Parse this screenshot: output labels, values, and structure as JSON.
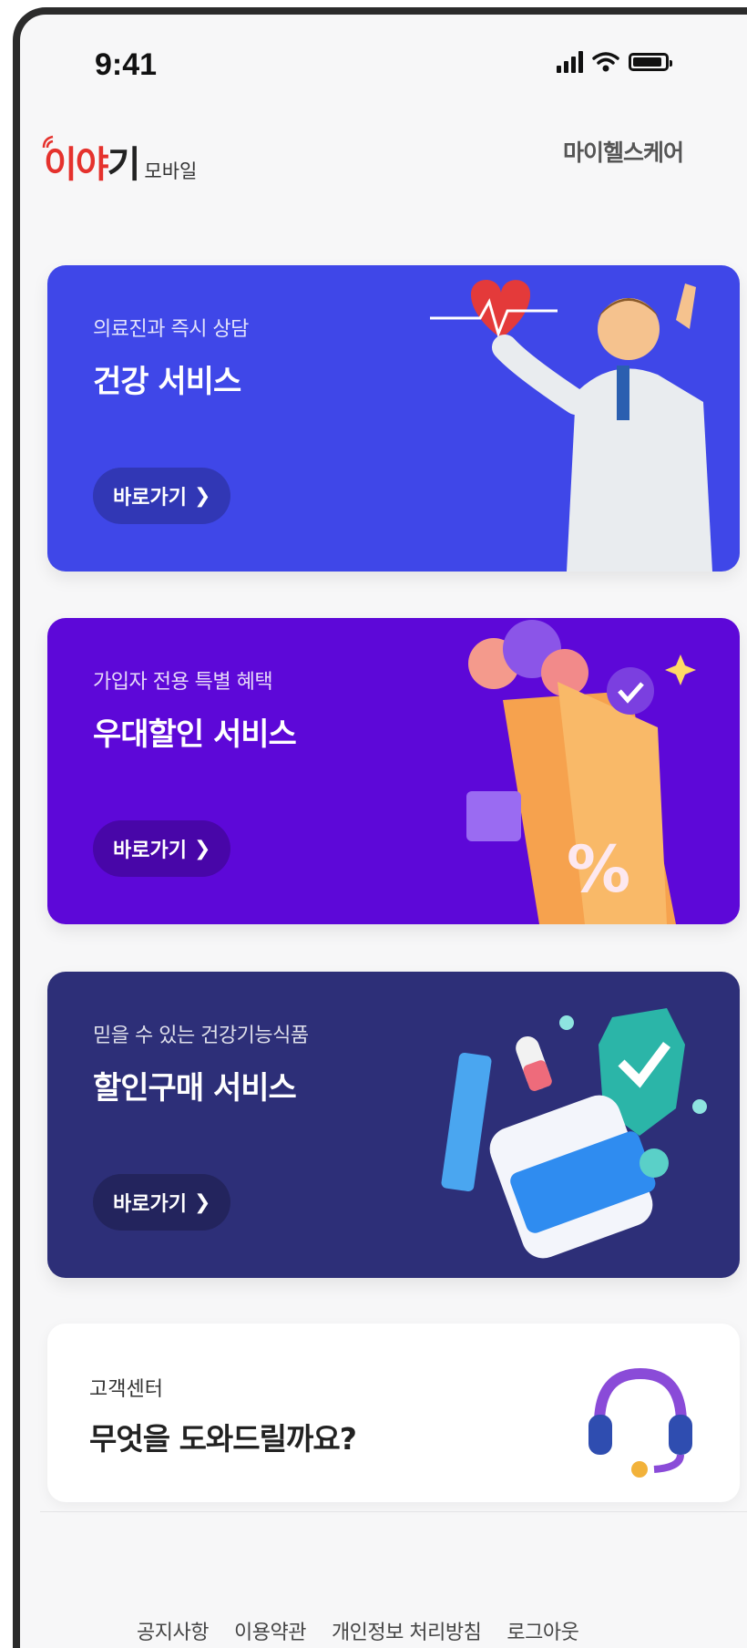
{
  "status_bar": {
    "time": "9:41"
  },
  "header": {
    "logo_main_red": "이야",
    "logo_main_dark": "기",
    "logo_sub": "모바일",
    "menu_label": "마이헬스케어"
  },
  "cards": [
    {
      "subtitle": "의료진과 즉시 상담",
      "title": "건강 서비스",
      "button": "바로가기",
      "color": "#3f47e8",
      "art": "doctor-illustration"
    },
    {
      "subtitle": "가입자 전용 특별 혜택",
      "title": "우대할인 서비스",
      "button": "바로가기",
      "color": "#5d08d8",
      "art": "discount-illustration"
    },
    {
      "subtitle": "믿을 수 있는 건강기능식품",
      "title": "할인구매 서비스",
      "button": "바로가기",
      "color": "#2d2f78",
      "art": "supplement-illustration"
    }
  ],
  "support": {
    "subtitle": "고객센터",
    "title": "무엇을 도와드릴까요?",
    "icon": "headset-icon"
  },
  "footer": {
    "links": [
      "공지사항",
      "이용약관",
      "개인정보 처리방침",
      "로그아웃"
    ]
  },
  "battery_level": 0.9
}
